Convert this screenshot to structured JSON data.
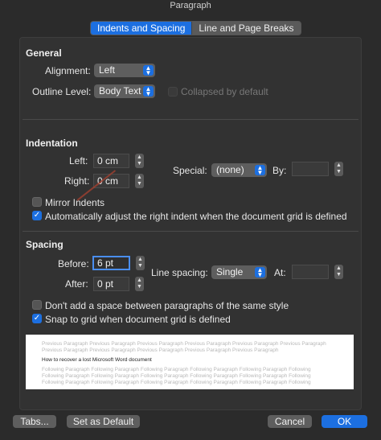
{
  "window": {
    "title": "Paragraph"
  },
  "tabs": [
    {
      "label": "Indents and Spacing",
      "active": true
    },
    {
      "label": "Line and Page Breaks",
      "active": false
    }
  ],
  "general": {
    "heading": "General",
    "alignment_label": "Alignment:",
    "alignment_value": "Left",
    "outline_label": "Outline Level:",
    "outline_value": "Body Text",
    "collapsed_label": "Collapsed by default"
  },
  "indentation": {
    "heading": "Indentation",
    "left_label": "Left:",
    "left_value": "0 cm",
    "right_label": "Right:",
    "right_value": "0 cm",
    "special_label": "Special:",
    "special_value": "(none)",
    "by_label": "By:",
    "mirror_label": "Mirror Indents",
    "auto_adjust_label": "Automatically adjust the right indent when the document grid is defined"
  },
  "spacing": {
    "heading": "Spacing",
    "before_label": "Before:",
    "before_value": "6 pt",
    "after_label": "After:",
    "after_value": "0 pt",
    "line_spacing_label": "Line spacing:",
    "line_spacing_value": "Single",
    "at_label": "At:",
    "no_space_label": "Don't add a space between paragraphs of the same style",
    "snap_label": "Snap to grid when document grid is defined"
  },
  "preview": {
    "prev1": "Previous Paragraph Previous Paragraph Previous Paragraph Previous Paragraph Previous Paragraph Previous Paragraph",
    "prev2": "Previous Paragraph Previous Paragraph Previous Paragraph Previous Paragraph Previous Paragraph",
    "current": "How to recover a lost Microsoft Word document",
    "follow1": "Following Paragraph Following Paragraph Following Paragraph Following Paragraph Following Paragraph Following",
    "follow2": "Following Paragraph Following Paragraph Following Paragraph Following Paragraph Following Paragraph Following",
    "follow3": "Following Paragraph Following Paragraph Following Paragraph Following Paragraph Following Paragraph Following"
  },
  "footer": {
    "tabs_button": "Tabs...",
    "default_button": "Set as Default",
    "cancel_button": "Cancel",
    "ok_button": "OK"
  }
}
